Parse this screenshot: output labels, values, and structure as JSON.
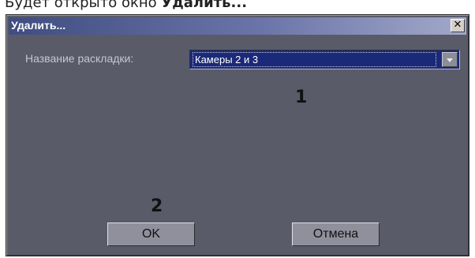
{
  "page": {
    "text_prefix": "Будет открыто окно ",
    "text_bold": "Удалить..."
  },
  "dialog": {
    "title": "Удалить...",
    "close_glyph": "✕",
    "field_label": "Название раскладки:",
    "layout_value": "Камеры 2 и 3",
    "markers": {
      "one": "1",
      "two": "2"
    },
    "ok_label": "OK",
    "cancel_label": "Отмена"
  },
  "colors": {
    "dialog_bg": "#5a5b69",
    "combo_bg": "#1b2a78",
    "button_bg": "#8f909c"
  },
  "icons": {
    "close": "close-icon",
    "dropdown": "chevron-down-icon"
  }
}
